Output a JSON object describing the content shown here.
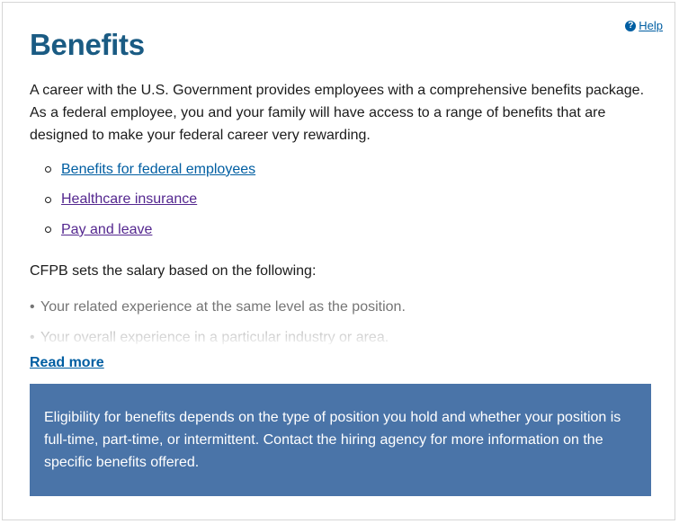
{
  "help": {
    "icon": "question-circle-icon",
    "label": "Help"
  },
  "title": "Benefits",
  "intro": "A career with the U.S. Government provides employees with a comprehensive benefits package. As a federal employee, you and your family will have access to a range of benefits that are designed to make your federal career very rewarding.",
  "links": [
    {
      "label": "Benefits for federal employees"
    },
    {
      "label": "Healthcare insurance"
    },
    {
      "label": "Pay and leave"
    }
  ],
  "salary": {
    "heading": "CFPB sets the salary based on the following:",
    "items": [
      "Your related experience at the same level as the position.",
      "Your overall experience in a particular industry or area."
    ],
    "read_more": "Read more"
  },
  "notice": "Eligibility for benefits depends on the type of position you hold and whether your position is full-time, part-time, or intermittent. Contact the hiring agency for more information on the specific benefits offered.",
  "colors": {
    "title": "#1a5b83",
    "link": "#005ea2",
    "visited_link": "#54278f",
    "notice_bg": "#4a74a8"
  }
}
